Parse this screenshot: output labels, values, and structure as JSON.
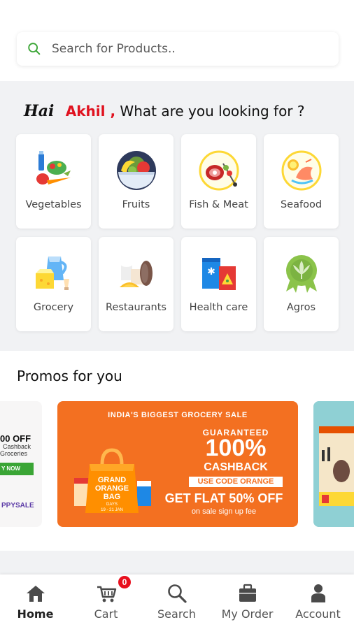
{
  "search": {
    "placeholder": "Search for Products..",
    "icon": "search-icon"
  },
  "greeting": {
    "hai": "Hai",
    "user_name": "Akhil ,",
    "prompt": "What are you looking for ?"
  },
  "categories": [
    {
      "label": "Vegetables",
      "icon": "vegetables-icon"
    },
    {
      "label": "Fruits",
      "icon": "fruits-icon"
    },
    {
      "label": "Fish & Meat",
      "icon": "fish-meat-icon"
    },
    {
      "label": "Seafood",
      "icon": "seafood-icon"
    },
    {
      "label": "Grocery",
      "icon": "grocery-icon"
    },
    {
      "label": "Restaurants",
      "icon": "restaurants-icon"
    },
    {
      "label": "Health care",
      "icon": "health-care-icon"
    },
    {
      "label": "Agros",
      "icon": "agros-icon"
    }
  ],
  "promos": {
    "title": "Promos for you",
    "left_banner": {
      "offer": "00 OFF",
      "line1": "Cashback",
      "line2": "Groceries",
      "button": "Y NOW",
      "brand": "PPYSALE"
    },
    "main_banner": {
      "headline": "INDIA'S BIGGEST GROCERY SALE",
      "guaranteed": "GUARANTEED",
      "percent": "100%",
      "cashback": "CASHBACK",
      "code": "USE CODE ORANGE",
      "flat": "GET FLAT 50% OFF",
      "fee": "on sale sign up fee",
      "bag_text": "GRAND ORANGE BAG",
      "bag_sub": "DAYS",
      "bag_dates": "19 - 21 JAN"
    }
  },
  "nav": {
    "items": [
      {
        "label": "Home",
        "icon": "home-icon",
        "active": true
      },
      {
        "label": "Cart",
        "icon": "cart-icon",
        "badge": "0"
      },
      {
        "label": "Search",
        "icon": "search-icon"
      },
      {
        "label": "My Order",
        "icon": "briefcase-icon"
      },
      {
        "label": "Account",
        "icon": "user-icon"
      }
    ]
  },
  "colors": {
    "accent_red": "#e0121f",
    "promo_orange": "#f37021",
    "search_icon_green": "#3aa535"
  }
}
